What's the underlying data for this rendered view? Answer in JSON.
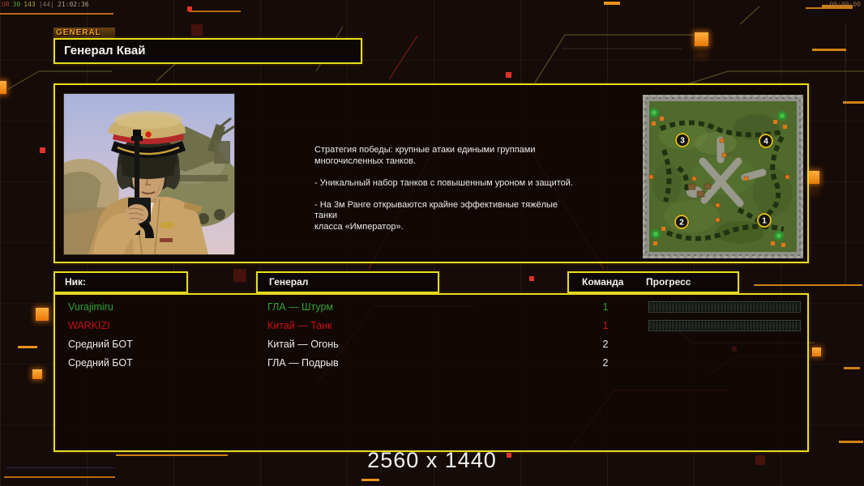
{
  "status_bar": {
    "left_parts": [
      "UR",
      "30",
      "143",
      "|44|",
      "21:02:36"
    ],
    "right_timer": "00:00:00"
  },
  "header": {
    "tab_label": "GENERAL",
    "title": "Генерал Квай"
  },
  "general_panel": {
    "description": "Стратегия победы: крупные атаки едиными группами\n многочисленных танков.\n\n- Уникальный набор танков с повышенным уроном и защитой.\n\n- На 3м Ранге открываются крайне эффективные тяжёлые танки\n класса «Император»."
  },
  "minimap": {
    "markers": [
      {
        "label": "3"
      },
      {
        "label": "4"
      },
      {
        "label": "2"
      },
      {
        "label": "1"
      }
    ]
  },
  "lobby_table": {
    "headers": {
      "nick": "Ник:",
      "general": "Генерал",
      "team": "Команда",
      "progress": "Прогресс"
    },
    "players": [
      {
        "name": "Vurajimiru",
        "general": "ГЛА — Штурм",
        "team": "1",
        "color": "#33a233",
        "has_progress_bar": true
      },
      {
        "name": "WARKIZI",
        "general": "Китай — Танк",
        "team": "1",
        "color": "#cc1111",
        "has_progress_bar": true
      },
      {
        "name": "Средний БОТ",
        "general": "Китай — Огонь",
        "team": "2",
        "color": "#eaeaea",
        "has_progress_bar": false
      },
      {
        "name": "Средний БОТ",
        "general": "ГЛА — Подрыв",
        "team": "2",
        "color": "#eaeaea",
        "has_progress_bar": false
      }
    ]
  },
  "footer": {
    "resolution_label": "2560 x 1440"
  },
  "colors": {
    "panel_border": "#e6dd1f",
    "accent_orange": "#f6880e",
    "alert_red": "#d03020"
  }
}
